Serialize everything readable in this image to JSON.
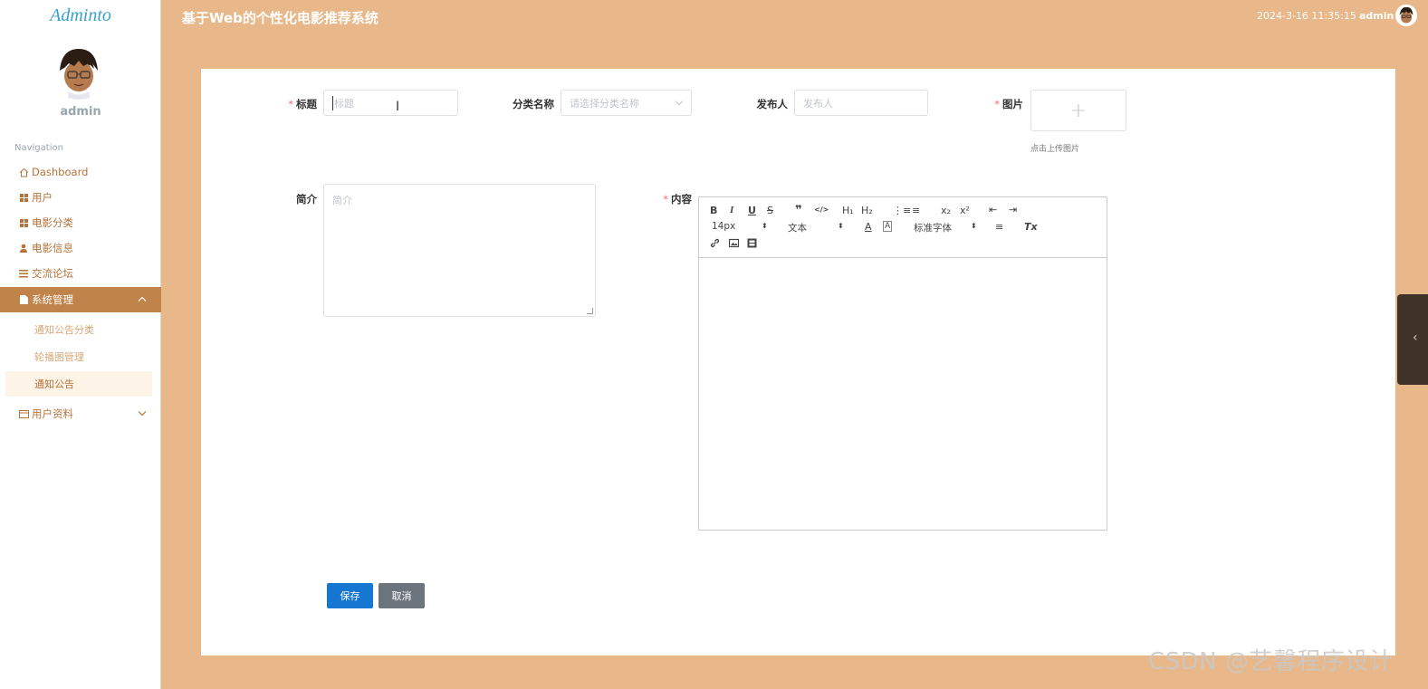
{
  "sidebar": {
    "logo": "Adminto",
    "username": "admin",
    "nav_title": "Navigation",
    "items": [
      {
        "label": "Dashboard"
      },
      {
        "label": "用户"
      },
      {
        "label": "电影分类"
      },
      {
        "label": "电影信息"
      },
      {
        "label": "交流论坛"
      },
      {
        "label": "系统管理"
      },
      {
        "label": "用户资料"
      }
    ],
    "sub_items": [
      {
        "label": "通知公告分类"
      },
      {
        "label": "轮播图管理"
      },
      {
        "label": "通知公告"
      }
    ]
  },
  "header": {
    "title": "基于Web的个性化电影推荐系统",
    "datetime": "2024-3-16 11:35:15",
    "user": "admin"
  },
  "form": {
    "title_label": "标题",
    "title_placeholder": "标题",
    "category_label": "分类名称",
    "category_placeholder": "请选择分类名称",
    "publisher_label": "发布人",
    "publisher_placeholder": "发布人",
    "image_label": "图片",
    "upload_plus": "+",
    "upload_hint": "点击上传图片",
    "intro_label": "简介",
    "intro_placeholder": "简介",
    "content_label": "内容",
    "required_mark": "*"
  },
  "editor": {
    "font_size": "14px",
    "text_type": "文本",
    "font_family": "标准字体",
    "buttons": {
      "bold": "B",
      "italic": "I",
      "underline": "U",
      "strike": "S",
      "quote": "❞",
      "code": "</>",
      "h1": "H₁",
      "h2": "H₂",
      "ol": "⋮≡",
      "ul": "≡",
      "sub": "x₂",
      "sup": "x²",
      "outdent": "⇤",
      "indent": "⇥",
      "color": "A",
      "bg": "A",
      "align": "≡",
      "clean": "Tx"
    }
  },
  "actions": {
    "save": "保存",
    "cancel": "取消"
  },
  "watermark": "CSDN @艺馨程序设计",
  "colors": {
    "background": "#e8b88a",
    "sidebar_active": "#c0834a",
    "primary": "#1677d2",
    "required": "#f56c6c"
  }
}
